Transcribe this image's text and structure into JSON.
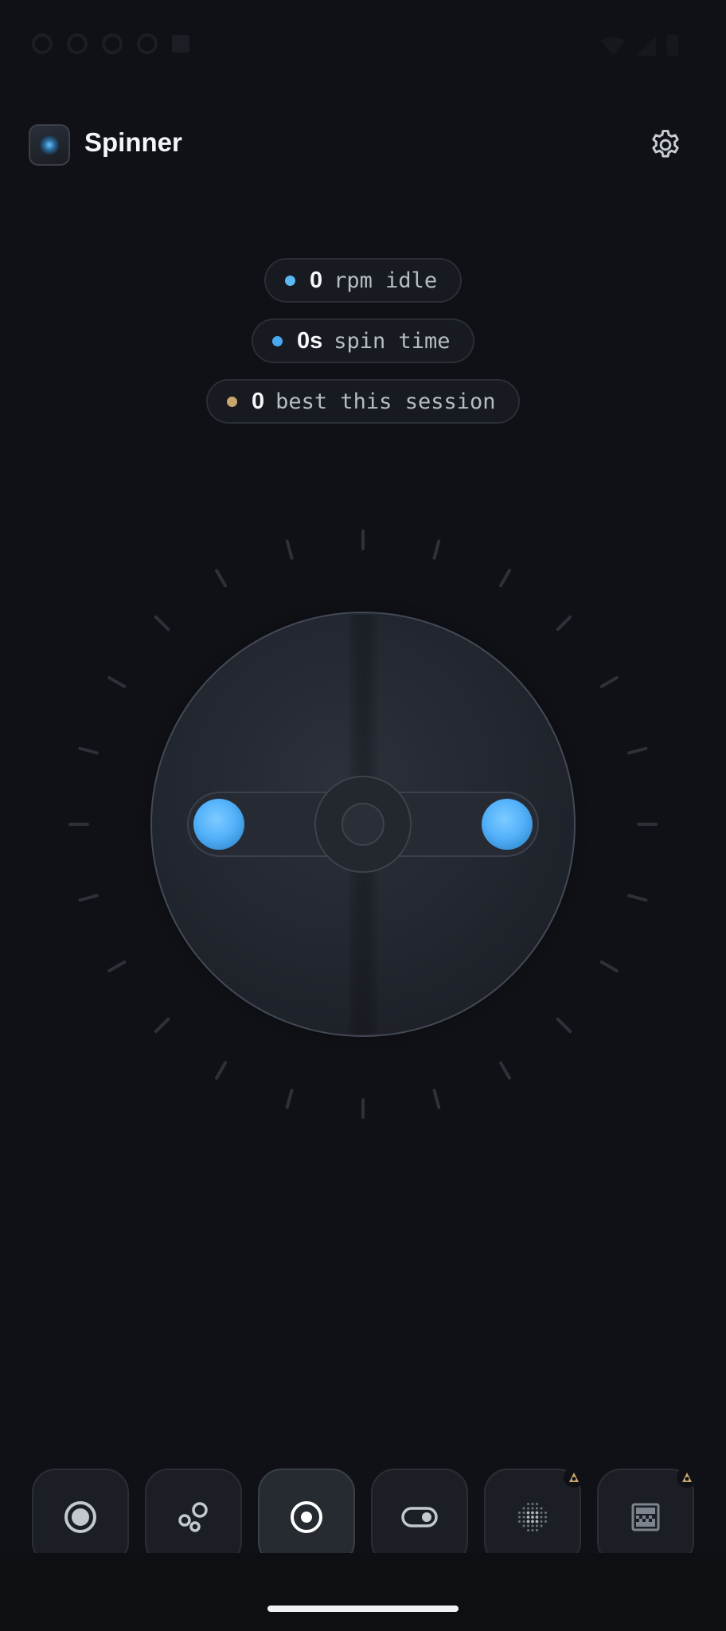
{
  "app": {
    "title": "Spinner",
    "icon": "spinner-logo-icon",
    "settings_icon": "gear-icon"
  },
  "stats": [
    {
      "value": "0",
      "label": "rpm idle",
      "dot_color": "#5ab8f3"
    },
    {
      "value": "0s",
      "label": "spin time",
      "dot_color": "#4aa8f0"
    },
    {
      "value": "0",
      "label": "best this session",
      "dot_color": "#c9a66b"
    }
  ],
  "spinner": {
    "accent_color": "#56b4ff",
    "tick_count": 24
  },
  "nav": {
    "items": [
      {
        "icon": "ring-icon",
        "active": false,
        "locked": false
      },
      {
        "icon": "bubbles-icon",
        "active": false,
        "locked": false
      },
      {
        "icon": "spinner-icon",
        "active": true,
        "locked": false
      },
      {
        "icon": "toggle-icon",
        "active": false,
        "locked": false
      },
      {
        "icon": "dot-grid-icon",
        "active": false,
        "locked": true
      },
      {
        "icon": "pixel-screen-icon",
        "active": false,
        "locked": true
      }
    ],
    "accent_color": "#4fb1f7",
    "lock_color": "#c9a66b"
  }
}
